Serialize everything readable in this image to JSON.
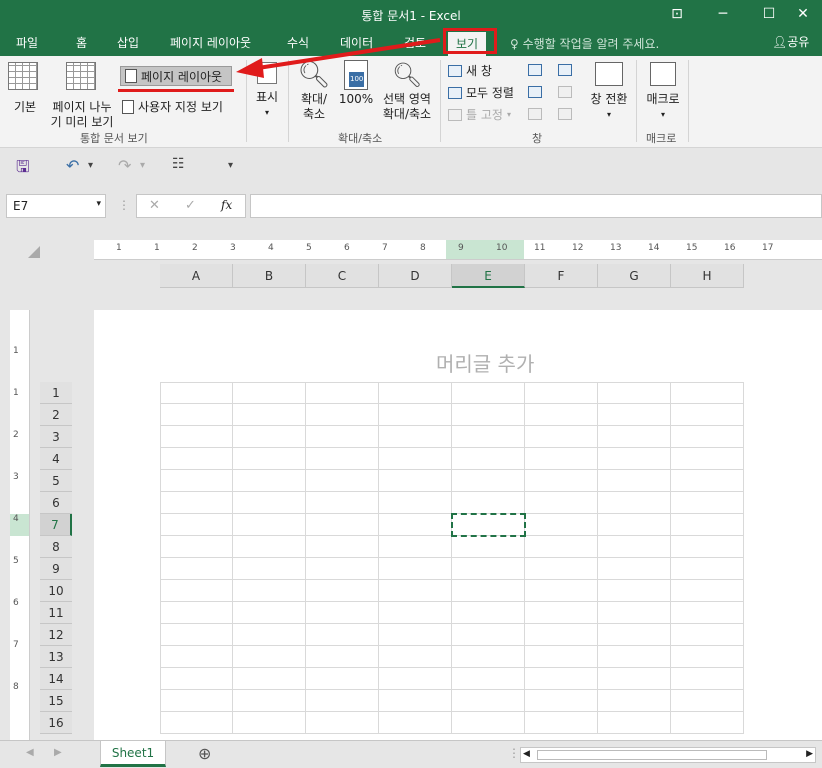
{
  "window": {
    "title": "통합 문서1 - Excel"
  },
  "tabs": [
    "파일",
    "홈",
    "삽입",
    "페이지 레이아웃",
    "수식",
    "데이터",
    "검토",
    "보기"
  ],
  "active_tab": "보기",
  "tell_me": "수행할 작업을 알려 주세요.",
  "share_label": "공유",
  "ribbon": {
    "workbook_views": {
      "normal": "기본",
      "page_break_line1": "페이지 나누",
      "page_break_line2": "기 미리 보기",
      "page_layout": "페이지 레이아웃",
      "custom_views": "사용자 지정 보기",
      "group_label": "통합 문서 보기"
    },
    "show": {
      "label": "표시"
    },
    "zoom": {
      "zoom_line1": "확대/",
      "zoom_line2": "축소",
      "hundred": "100%",
      "icon_text": "100",
      "sel_line1": "선택 영역",
      "sel_line2": "확대/축소",
      "group_label": "확대/축소"
    },
    "window": {
      "new_window": "새 창",
      "arrange_all": "모두 정렬",
      "freeze": "틀 고정",
      "switch_windows": "창 전환",
      "group_label": "창"
    },
    "macros": {
      "label": "매크로",
      "group_label": "매크로"
    }
  },
  "formula_bar": {
    "name_box": "E7",
    "fx": "fx",
    "value": ""
  },
  "ruler": {
    "numbers": [
      "1",
      "1",
      "2",
      "3",
      "4",
      "5",
      "6",
      "7",
      "8",
      "9",
      "10",
      "11",
      "12",
      "13",
      "14",
      "15",
      "16",
      "17"
    ]
  },
  "vruler": {
    "numbers": [
      "1",
      "1",
      "2",
      "3",
      "4",
      "5",
      "6",
      "7",
      "8"
    ]
  },
  "columns": [
    "A",
    "B",
    "C",
    "D",
    "E",
    "F",
    "G",
    "H"
  ],
  "selected_column": "E",
  "rows": [
    "1",
    "2",
    "3",
    "4",
    "5",
    "6",
    "7",
    "8",
    "9",
    "10",
    "11",
    "12",
    "13",
    "14",
    "15",
    "16"
  ],
  "selected_row": "7",
  "page_header_placeholder": "머리글 추가",
  "sheet_tab": "Sheet1",
  "colors": {
    "accent": "#217346",
    "annotation": "#e01b1b"
  }
}
